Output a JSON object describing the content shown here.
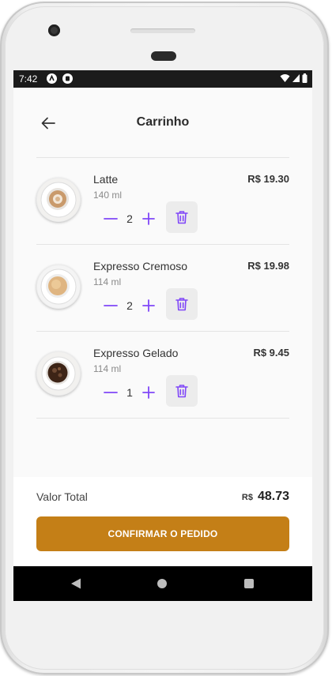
{
  "status_bar": {
    "time": "7:42"
  },
  "header": {
    "title": "Carrinho"
  },
  "cart": {
    "items": [
      {
        "name": "Latte",
        "size": "140 ml",
        "price": "R$ 19.30",
        "quantity": "2"
      },
      {
        "name": "Expresso Cremoso",
        "size": "114 ml",
        "price": "R$ 19.98",
        "quantity": "2"
      },
      {
        "name": "Expresso Gelado",
        "size": "114 ml",
        "price": "R$ 9.45",
        "quantity": "1"
      }
    ]
  },
  "footer": {
    "total_label": "Valor Total",
    "total_currency": "R$",
    "total_amount": "48.73",
    "confirm_label": "CONFIRMAR O PEDIDO"
  },
  "colors": {
    "accent_purple": "#8047f8",
    "confirm_button": "#c47f17"
  },
  "icons": {
    "back": "arrow-left-icon",
    "minus": "minus-icon",
    "plus": "plus-icon",
    "remove": "trash-icon"
  }
}
